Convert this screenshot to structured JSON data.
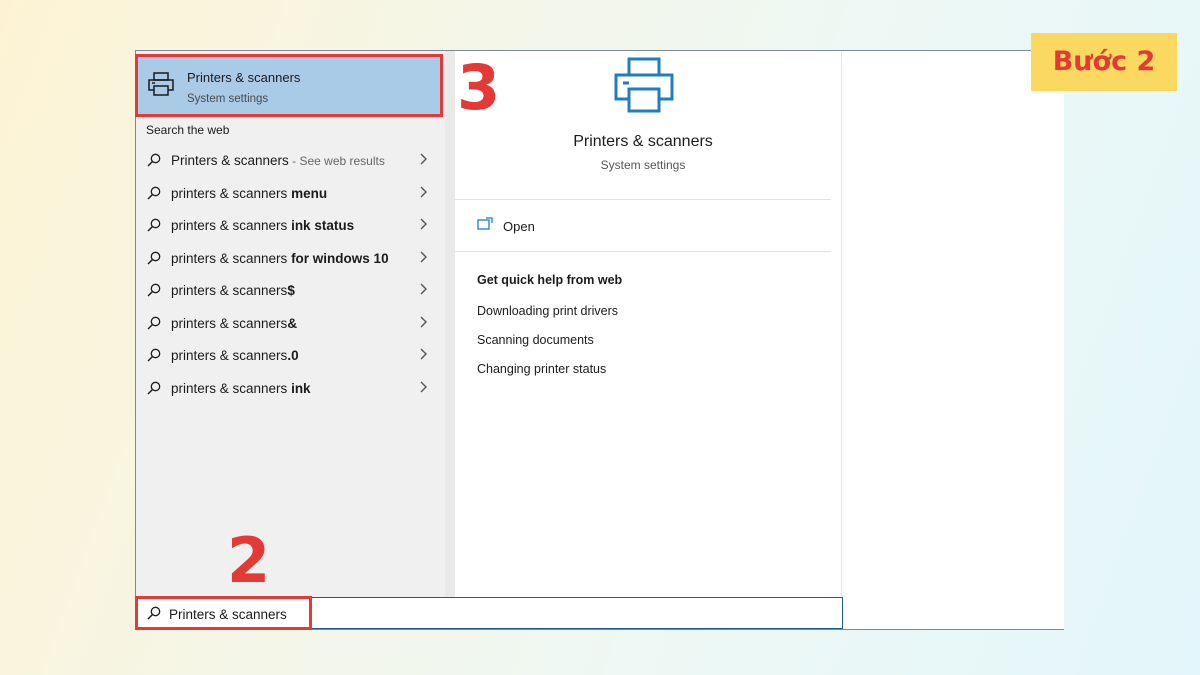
{
  "best_match": {
    "title": "Printers & scanners",
    "subtitle": "System settings",
    "icon": "printer-icon"
  },
  "web_section_label": "Search the web",
  "web_results": [
    {
      "base": "Printers & scanners",
      "bold": "",
      "hint": " - See web results"
    },
    {
      "base": "printers & scanners ",
      "bold": "menu",
      "hint": ""
    },
    {
      "base": "printers & scanners ",
      "bold": "ink status",
      "hint": ""
    },
    {
      "base": "printers & scanners ",
      "bold": "for windows 10",
      "hint": ""
    },
    {
      "base": "printers & scanners",
      "bold": "$",
      "hint": ""
    },
    {
      "base": "printers & scanners",
      "bold": "&",
      "hint": ""
    },
    {
      "base": "printers & scanners",
      "bold": ".0",
      "hint": ""
    },
    {
      "base": "printers & scanners ",
      "bold": "ink",
      "hint": ""
    }
  ],
  "detail": {
    "title": "Printers & scanners",
    "subtitle": "System settings",
    "open_label": "Open",
    "quick_help_title": "Get quick help from web",
    "quick_links": [
      "Downloading print drivers",
      "Scanning documents",
      "Changing printer status"
    ]
  },
  "search": {
    "value": "Printers & scanners"
  },
  "annotations": {
    "step_label": "Bước 2",
    "marker_best_match": "3",
    "marker_search": "2"
  },
  "colors": {
    "highlight": "#e53935",
    "best_match_bg": "#a9cbe8",
    "printer_icon": "#1f7ec1",
    "badge_bg": "#fbd860"
  }
}
